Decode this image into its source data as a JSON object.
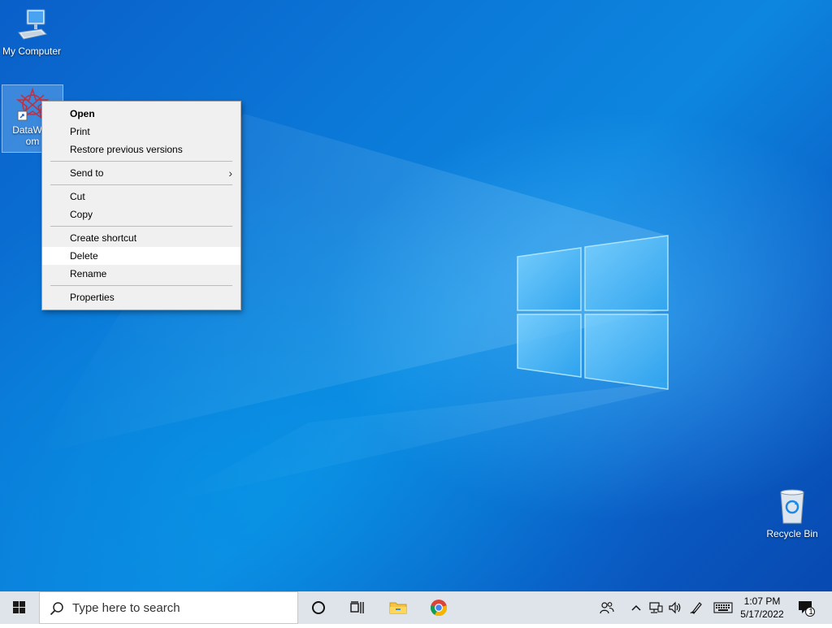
{
  "desktop": {
    "icons": [
      {
        "label": "My Computer"
      },
      {
        "label": "DataWag \nom"
      },
      {
        "label": "Recycle Bin"
      }
    ],
    "shortcut_label_line1": "DataWag",
    "shortcut_label_line2": "om"
  },
  "context_menu": {
    "open": "Open",
    "print": "Print",
    "restore": "Restore previous versions",
    "send_to": "Send to",
    "cut": "Cut",
    "copy": "Copy",
    "create_shortcut": "Create shortcut",
    "delete": "Delete",
    "rename": "Rename",
    "properties": "Properties"
  },
  "taskbar": {
    "search_placeholder": "Type here to search",
    "time": "1:07 PM",
    "date": "5/17/2022",
    "notification_count": "1",
    "icons": [
      "windows-start-icon",
      "search-icon",
      "cortana-icon",
      "task-view-icon",
      "file-explorer-icon",
      "chrome-icon",
      "people-icon",
      "chevron-up-icon",
      "network-icon",
      "volume-icon",
      "pen-icon",
      "keyboard-icon",
      "notification-icon"
    ]
  },
  "colors": {
    "taskbar_bg": "#dfe4ea",
    "menu_bg": "#f0f0f0",
    "desktop_blue": "#0b7ad8"
  }
}
